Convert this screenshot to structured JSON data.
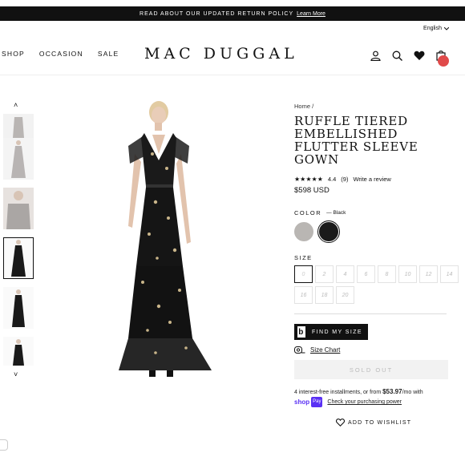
{
  "announcement": {
    "text": "READ ABOUT OUR UPDATED RETURN POLICY",
    "link": "Learn More"
  },
  "language": {
    "label": "English",
    "icon": "chevron-down-icon"
  },
  "nav": {
    "items": [
      "SHOP",
      "OCCASION",
      "SALE"
    ]
  },
  "brand": {
    "logo": "MAC DUGGAL"
  },
  "header_icons": [
    "user-icon",
    "search-icon",
    "heart-icon",
    "cart-icon"
  ],
  "product": {
    "breadcrumb": "Home /",
    "title": "RUFFLE TIERED EMBELLISHED FLUTTER SLEEVE GOWN",
    "rating": {
      "stars": "★★★★★",
      "value": "4.4",
      "count": "(9)",
      "write_review": "Write a review",
      "score": 4.4
    },
    "price": "$598 USD",
    "color_label": "COLOR",
    "color_value": "— Black",
    "swatches": [
      {
        "name": "silver",
        "color": "#b9b6b3",
        "selected": false
      },
      {
        "name": "black",
        "color": "#1a1a1a",
        "selected": true
      }
    ],
    "size_label": "SIZE",
    "sizes": [
      "0",
      "2",
      "4",
      "6",
      "8",
      "10",
      "12",
      "14",
      "16",
      "18",
      "20"
    ],
    "find_my_size": "FIND MY SIZE",
    "size_chart": "Size Chart",
    "sold_out": "SOLD OUT",
    "installments": {
      "pre": "4 interest-free installments, or from",
      "amount": "$53.97",
      "post": "/mo with",
      "shop": "shop",
      "pay": "Pay",
      "check": "Check your purchasing power"
    },
    "wishlist": "ADD TO WISHLIST"
  },
  "colors": {
    "accent": "#111111",
    "shop_pay": "#5a31f4",
    "cart_dot": "#e04a4a"
  }
}
